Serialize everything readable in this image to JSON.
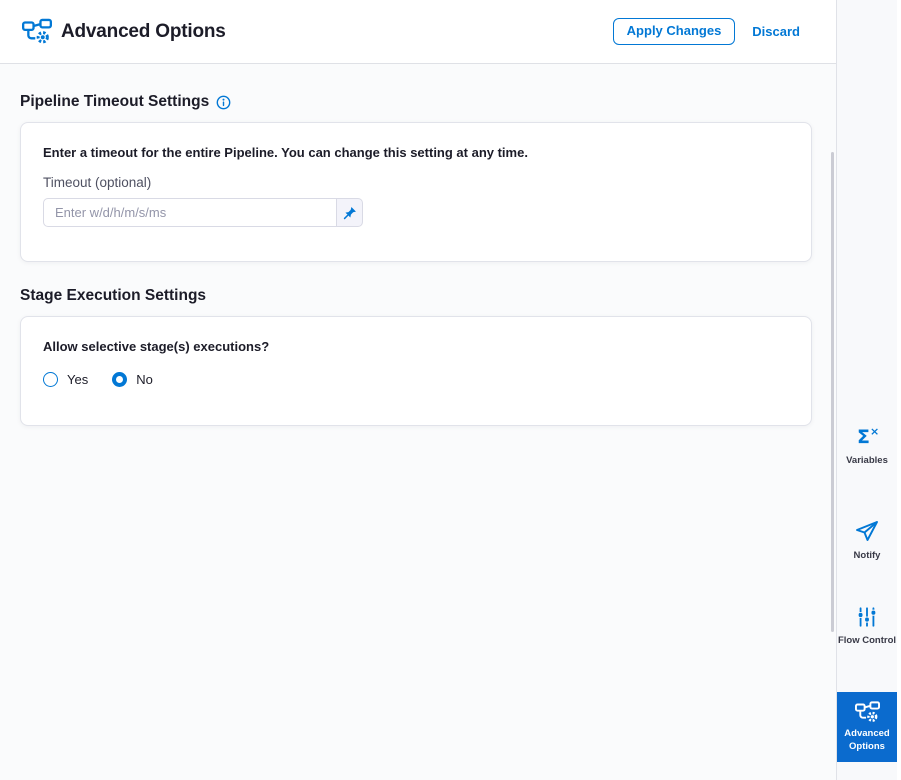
{
  "header": {
    "title": "Advanced Options",
    "apply_button": "Apply Changes",
    "discard_link": "Discard"
  },
  "pipeline_timeout": {
    "heading": "Pipeline Timeout Settings",
    "info_icon": "info-icon",
    "description": "Enter a timeout for the entire Pipeline. You can change this setting at any time.",
    "timeout_label": "Timeout (optional)",
    "timeout_value": "",
    "timeout_placeholder": "Enter w/d/h/m/s/ms",
    "pin_icon": "pin-icon"
  },
  "stage_execution": {
    "heading": "Stage Execution Settings",
    "question": "Allow selective stage(s) executions?",
    "options": [
      {
        "label": "Yes",
        "selected": false
      },
      {
        "label": "No",
        "selected": true
      }
    ]
  },
  "sidebar": {
    "items": [
      {
        "label": "Variables",
        "icon": "sigma-x-icon",
        "selected": false
      },
      {
        "label": "Notify",
        "icon": "paper-plane-icon",
        "selected": false
      },
      {
        "label": "Flow Control",
        "icon": "sliders-icon",
        "selected": false
      },
      {
        "label": "Advanced Options",
        "icon": "pipeline-gear-icon",
        "selected": true
      }
    ]
  },
  "colors": {
    "accent_blue": "#0278d5",
    "selected_nav_bg": "#0b6bce",
    "heading_text": "#1c1c28",
    "muted_label": "#4f5162",
    "content_bg": "#fafbfc",
    "sidebar_bg": "#f8f9fb"
  }
}
